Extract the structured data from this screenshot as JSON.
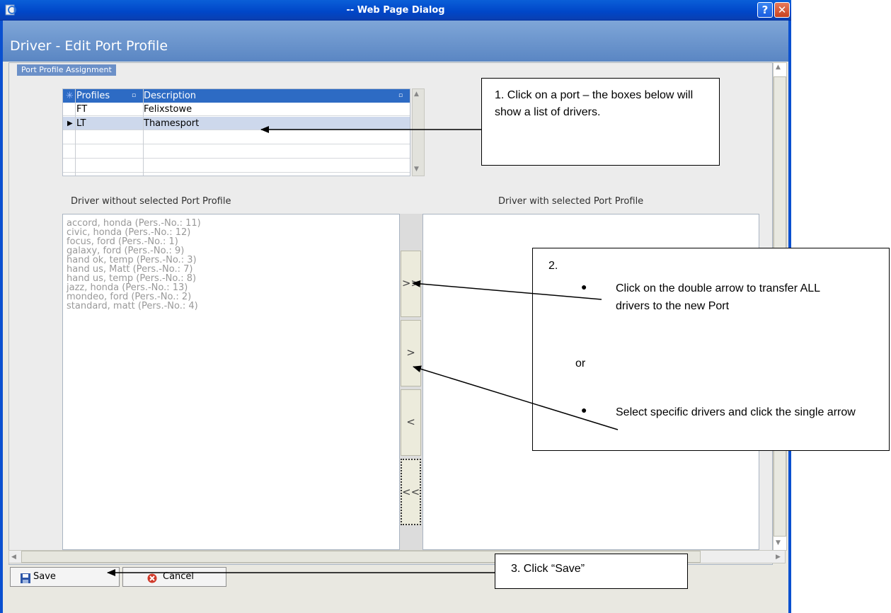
{
  "window": {
    "title": "-- Web Page Dialog",
    "help_glyph": "?",
    "close_glyph": "✕"
  },
  "dialog": {
    "title": "Driver - Edit Port Profile",
    "section_label": "Port Profile Assignment"
  },
  "profiles_grid": {
    "columns": [
      "Profiles",
      "Description"
    ],
    "rows": [
      {
        "code": "FT",
        "description": "Felixstowe",
        "selected": false
      },
      {
        "code": "LT",
        "description": "Thamesport",
        "selected": true
      }
    ]
  },
  "lists": {
    "left_label": "Driver without selected Port Profile",
    "right_label": "Driver with selected Port Profile",
    "left_items": [
      "accord, honda (Pers.-No.: 11)",
      "civic, honda (Pers.-No.: 12)",
      "focus, ford (Pers.-No.: 1)",
      "galaxy, ford (Pers.-No.: 9)",
      "hand ok, temp (Pers.-No.: 3)",
      "hand us, Matt (Pers.-No.: 7)",
      "hand us, temp (Pers.-No.: 8)",
      "jazz, honda (Pers.-No.: 13)",
      "mondeo, ford (Pers.-No.: 2)",
      "standard, matt (Pers.-No.: 4)"
    ],
    "right_items": []
  },
  "transfer_buttons": {
    "add_all": ">>",
    "add_one": ">",
    "remove_one": "<",
    "remove_all": "<<"
  },
  "buttons": {
    "save": "Save",
    "cancel": "Cancel"
  },
  "callouts": {
    "c1": "1. Click on a port – the boxes below  will show a list of drivers.",
    "c2_num": "2.",
    "c2_b1": "Click on the double arrow to transfer ALL drivers to the new Port",
    "c2_or": "or",
    "c2_b2": "Select specific drivers and click the single arrow",
    "c3": "3.  Click “Save”"
  },
  "colors": {
    "titlebar": "#0046c8",
    "header": "#6b90c8",
    "grid_header": "#2d6bc4",
    "selected_row": "#cdd8ec"
  }
}
